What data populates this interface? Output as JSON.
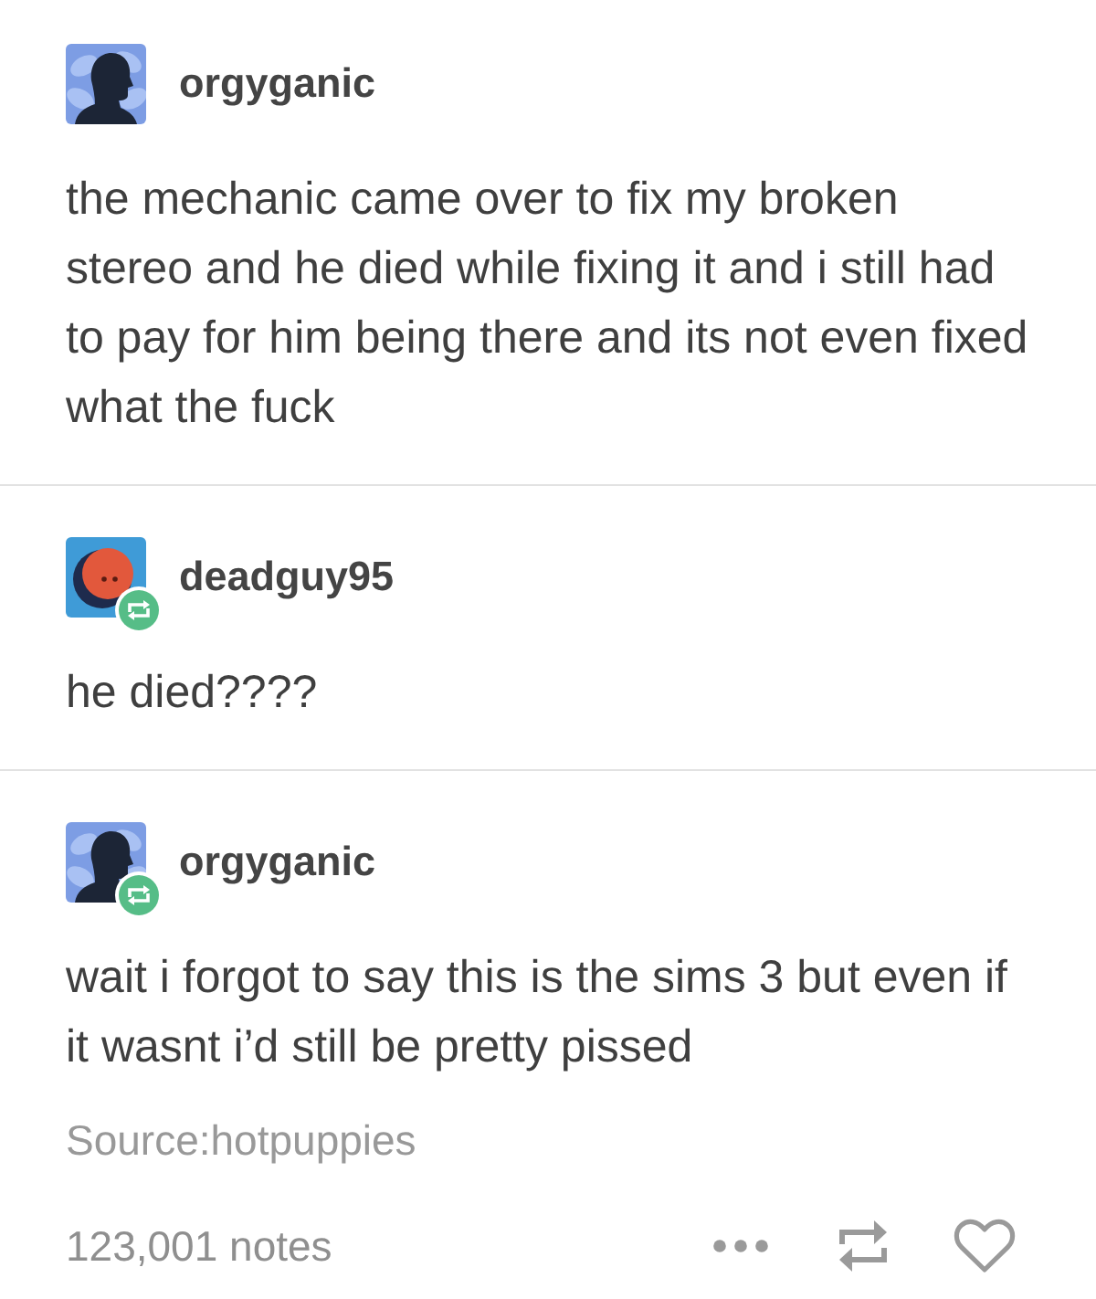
{
  "posts": [
    {
      "username": "orgyganic",
      "avatar": {
        "kind": "silhouette"
      },
      "reblogged": false,
      "body": "the mechanic came over to fix my broken stereo and he died while fixing it and i still had to pay for him being there and its not even fixed what the fuck"
    },
    {
      "username": "deadguy95",
      "avatar": {
        "kind": "face"
      },
      "reblogged": true,
      "body": "he died????"
    },
    {
      "username": "orgyganic",
      "avatar": {
        "kind": "silhouette"
      },
      "reblogged": true,
      "body": "wait i forgot to say this is the sims 3 but even if it wasnt i’d still be pretty pissed"
    }
  ],
  "source": "Source:hotpuppies",
  "footer": {
    "notes": "123,001 notes"
  }
}
